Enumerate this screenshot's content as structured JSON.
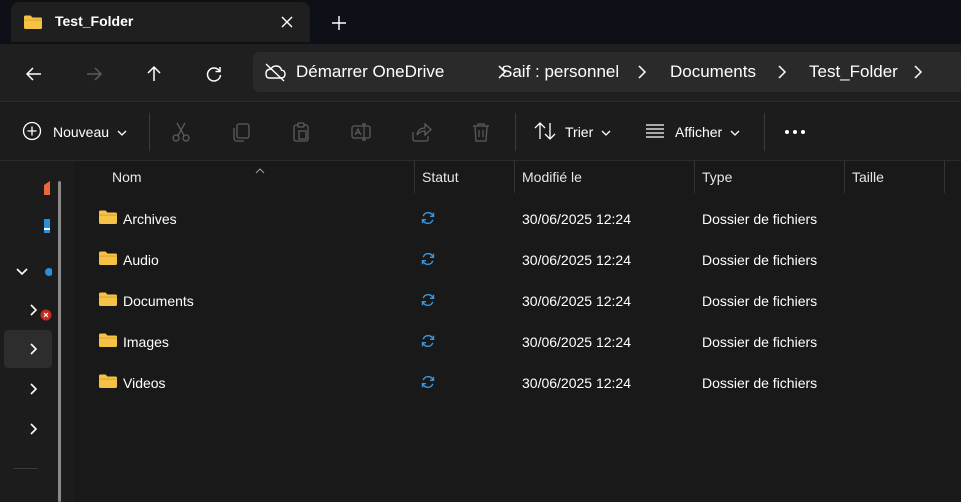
{
  "tab": {
    "title": "Test_Folder",
    "icon": "folder-icon",
    "close_icon": "close-icon",
    "new_tab_icon": "plus-icon"
  },
  "nav": {
    "back_icon": "arrow-left-icon",
    "forward_icon": "arrow-right-icon",
    "up_icon": "arrow-up-icon",
    "refresh_icon": "refresh-icon"
  },
  "breadcrumb": {
    "status_icon": "cloud-off-icon",
    "items": [
      "Démarrer OneDrive",
      "Saif : personnel",
      "Documents",
      "Test_Folder"
    ]
  },
  "commandbar": {
    "new_label": "Nouveau",
    "sort_label": "Trier",
    "view_label": "Afficher",
    "more_icon": "more-icon",
    "disabled_icons": [
      "cut-icon",
      "copy-icon",
      "paste-icon",
      "rename-icon",
      "share-icon",
      "delete-icon"
    ]
  },
  "columns": {
    "name": "Nom",
    "status": "Statut",
    "modified": "Modifié le",
    "type": "Type",
    "size": "Taille"
  },
  "files": [
    {
      "name": "Archives",
      "modified": "30/06/2025 12:24",
      "type": "Dossier de fichiers",
      "status": "sync-icon"
    },
    {
      "name": "Audio",
      "modified": "30/06/2025 12:24",
      "type": "Dossier de fichiers",
      "status": "sync-icon"
    },
    {
      "name": "Documents",
      "modified": "30/06/2025 12:24",
      "type": "Dossier de fichiers",
      "status": "sync-icon"
    },
    {
      "name": "Images",
      "modified": "30/06/2025 12:24",
      "type": "Dossier de fichiers",
      "status": "sync-icon"
    },
    {
      "name": "Videos",
      "modified": "30/06/2025 12:24",
      "type": "Dossier de fichiers",
      "status": "sync-icon"
    }
  ],
  "colors": {
    "background": "#191919",
    "folder": "#f5c245",
    "sync_accent": "#3a96dd",
    "text": "#ffffff",
    "disabled_icon": "#5c5c5c"
  }
}
